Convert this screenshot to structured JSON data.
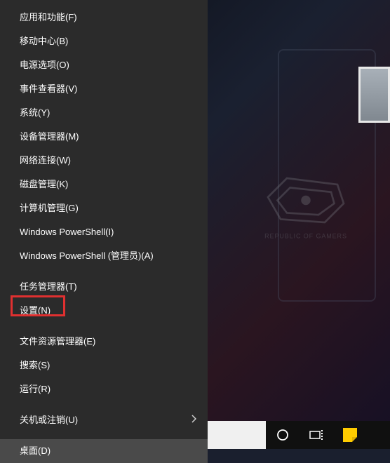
{
  "menu": {
    "groups": [
      [
        {
          "label": "应用和功能(F)",
          "name": "menu-apps-features"
        },
        {
          "label": "移动中心(B)",
          "name": "menu-mobility-center"
        },
        {
          "label": "电源选项(O)",
          "name": "menu-power-options"
        },
        {
          "label": "事件查看器(V)",
          "name": "menu-event-viewer"
        },
        {
          "label": "系统(Y)",
          "name": "menu-system"
        },
        {
          "label": "设备管理器(M)",
          "name": "menu-device-manager"
        },
        {
          "label": "网络连接(W)",
          "name": "menu-network-connections"
        },
        {
          "label": "磁盘管理(K)",
          "name": "menu-disk-management"
        },
        {
          "label": "计算机管理(G)",
          "name": "menu-computer-management"
        },
        {
          "label": "Windows PowerShell(I)",
          "name": "menu-powershell"
        },
        {
          "label": "Windows PowerShell (管理员)(A)",
          "name": "menu-powershell-admin"
        }
      ],
      [
        {
          "label": "任务管理器(T)",
          "name": "menu-task-manager"
        },
        {
          "label": "设置(N)",
          "name": "menu-settings",
          "highlighted": true
        }
      ],
      [
        {
          "label": "文件资源管理器(E)",
          "name": "menu-file-explorer"
        },
        {
          "label": "搜索(S)",
          "name": "menu-search"
        },
        {
          "label": "运行(R)",
          "name": "menu-run"
        }
      ],
      [
        {
          "label": "关机或注销(U)",
          "name": "menu-shutdown-signout",
          "submenu": true
        }
      ],
      [
        {
          "label": "桌面(D)",
          "name": "menu-desktop",
          "hovered": true
        }
      ]
    ]
  },
  "taskbar": {
    "cortana_name": "cortana-icon",
    "taskview_name": "task-view-icon",
    "sticky_name": "sticky-notes-icon"
  },
  "rog_text": "REPUBLIC OF GAMERS"
}
